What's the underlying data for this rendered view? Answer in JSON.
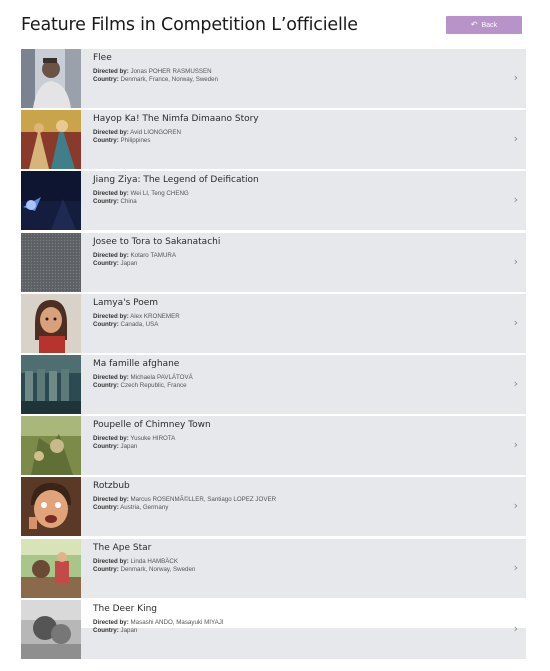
{
  "page": {
    "title": "Feature Films in Competition L’officielle",
    "back_label": "Back",
    "accent": "#b893c9"
  },
  "labels": {
    "directed_by": "Directed by:",
    "country": "Country:"
  },
  "films": [
    {
      "title": "Flee",
      "director": "Jonas POHER RASMUSSEN",
      "country": "Denmark, France, Norway, Sweden"
    },
    {
      "title": "Hayop Ka! The Nimfa Dimaano Story",
      "director": "Avid LIONGOREN",
      "country": "Philippines"
    },
    {
      "title": "Jiang Ziya: The Legend of Deification",
      "director": "Wei LI, Teng CHENG",
      "country": "China"
    },
    {
      "title": "Josee to Tora to Sakanatachi",
      "director": "Kotaro TAMURA",
      "country": "Japan"
    },
    {
      "title": "Lamya's Poem",
      "director": "Alex KRONEMER",
      "country": "Canada, USA"
    },
    {
      "title": "Ma famille afghane",
      "director": "Michaela PAVLÁTOVÁ",
      "country": "Czech Republic, France"
    },
    {
      "title": "Poupelle of Chimney Town",
      "director": "Yusuke HIROTA",
      "country": "Japan"
    },
    {
      "title": "Rotzbub",
      "director": "Marcus ROSENMÃ©LLER, Santiago LOPEZ JOVER",
      "country": "Austria, Germany"
    },
    {
      "title": "The Ape Star",
      "director": "Linda HAMBÄCK",
      "country": "Denmark, Norway, Sweden"
    },
    {
      "title": "The Deer King",
      "director": "Masashi ANDO, Masayuki MIYAJI",
      "country": "Japan"
    }
  ]
}
